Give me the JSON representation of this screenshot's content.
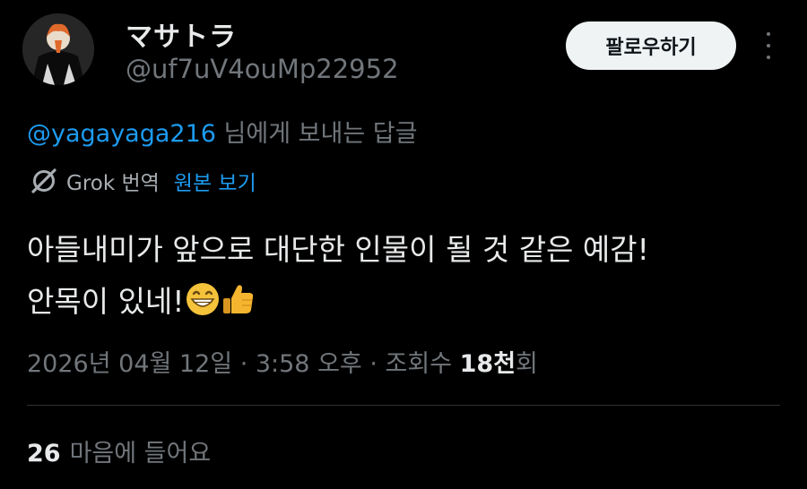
{
  "author": {
    "display_name": "マサトラ",
    "handle": "@uf7uV4ouMp22952"
  },
  "follow_button_label": "팔로우하기",
  "more_icon": "more-vertical-icon",
  "reply_context": {
    "mention": "@yagayaga216",
    "suffix": " 님에게 보내는 답글"
  },
  "translation": {
    "icon": "grok-icon",
    "label": "Grok 번역",
    "show_original_label": "원본 보기"
  },
  "tweet": {
    "line1": "아들내미가 앞으로 대단한 인물이 될 것 같은 예감!",
    "line2": "안목이 있네!",
    "emojis": [
      "grinning-face-emoji",
      "thumbs-up-emoji"
    ]
  },
  "meta": {
    "timestamp": "2026년 04월 12일 · 3:58 오후",
    "separator": " · ",
    "views_prefix": "조회수 ",
    "views_number": "18천",
    "views_suffix": "회"
  },
  "likes": {
    "count": "26",
    "label": "마음에 들어요"
  },
  "colors": {
    "background": "#000000",
    "text": "#e7e9ea",
    "secondary": "#71767b",
    "accent": "#1d9bf0",
    "follow_bg": "#eff3f4",
    "divider": "#2f3336"
  }
}
